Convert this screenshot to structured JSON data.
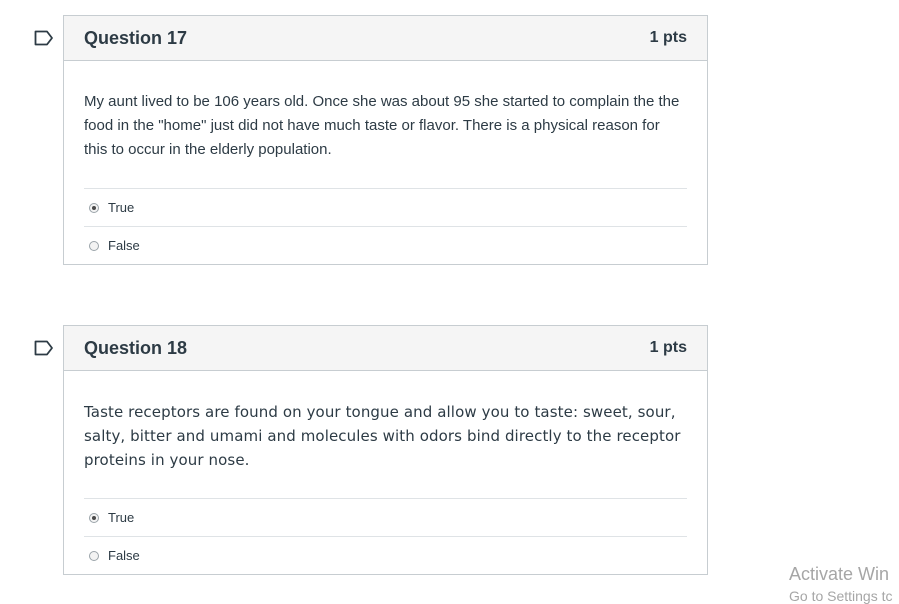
{
  "questions": [
    {
      "title": "Question 17",
      "points": "1 pts",
      "text": "My aunt lived to be 106 years old. Once she was about 95 she started to complain the the food in the \"home\" just did not have much taste or flavor. There is a physical reason for this to occur in the elderly population.",
      "answers": [
        {
          "label": "True",
          "selected": true
        },
        {
          "label": "False",
          "selected": false
        }
      ]
    },
    {
      "title": "Question 18",
      "points": "1 pts",
      "text": "Taste receptors are found on your tongue and allow you to taste: sweet, sour, salty, bitter and umami and molecules with odors bind directly to the receptor proteins in your nose.",
      "answers": [
        {
          "label": "True",
          "selected": true
        },
        {
          "label": "False",
          "selected": false
        }
      ]
    }
  ],
  "watermark": {
    "line1": "Activate Win",
    "line2": "Go to Settings tc"
  },
  "icons": {
    "flag": "flag-bookmark-icon"
  },
  "colors": {
    "border": "#c7cdd1",
    "header_bg": "#f5f5f5",
    "text": "#2d3b45"
  }
}
